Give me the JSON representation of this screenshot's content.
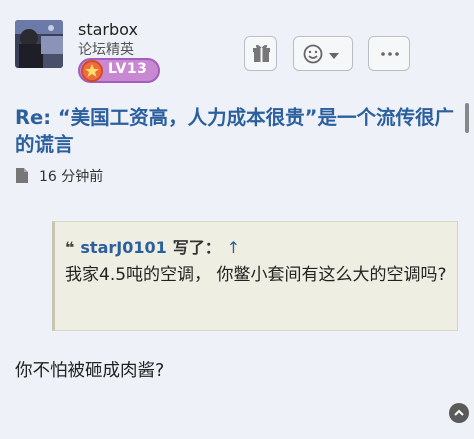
{
  "user": {
    "name": "starbox",
    "rank": "论坛精英",
    "level": "LV13"
  },
  "actions": {
    "gift_icon": "gift-icon",
    "react_icon": "smiley-icon",
    "more_icon": "more-dots-icon"
  },
  "post": {
    "title": "Re: “美国工资高，人力成本很贵”是一个流传很广的谎言",
    "time": "16 分钟前",
    "body": "你不怕被砸成肉酱?"
  },
  "quote": {
    "author": "starJ0101",
    "said": "写了：",
    "arrow": "↑",
    "text": "我家4.5吨的空调，  你鳖小套间有这么大的空调吗?"
  },
  "colors": {
    "background": "#eef1f7",
    "title": "#2b5f9e",
    "badge": "#c888d2",
    "quote_bg": "#efeee2"
  }
}
